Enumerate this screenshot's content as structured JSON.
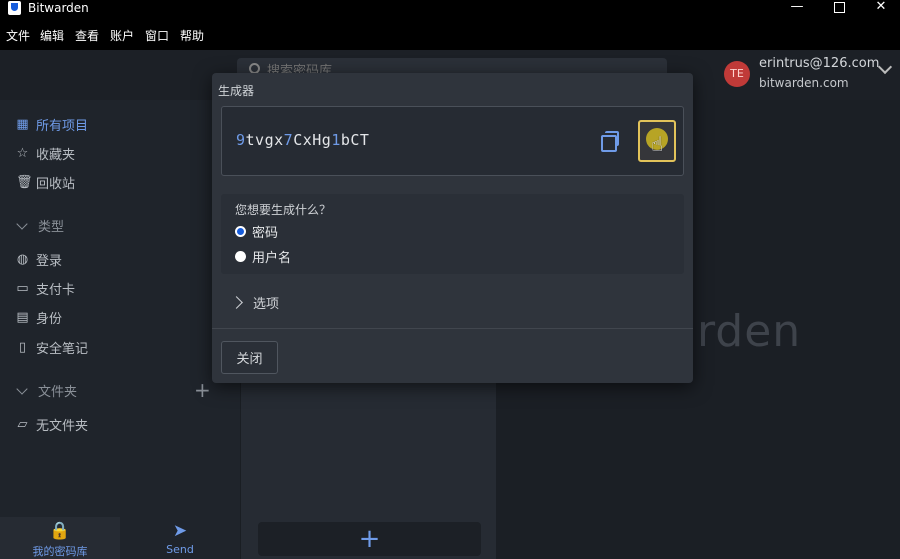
{
  "window": {
    "app_title": "Bitwarden",
    "minimize": "—",
    "close": "✕"
  },
  "menubar": {
    "items": [
      "文件",
      "编辑",
      "查看",
      "账户",
      "窗口",
      "帮助"
    ]
  },
  "header": {
    "search_placeholder": "搜索密码库",
    "account": {
      "avatar_initials": "TE",
      "email": "erintrus@126.com",
      "server": "bitwarden.com"
    }
  },
  "sidebar": {
    "items": [
      {
        "label": "所有项目",
        "icon": "grid-icon",
        "active": true
      },
      {
        "label": "收藏夹",
        "icon": "star-icon"
      },
      {
        "label": "回收站",
        "icon": "trash-icon"
      }
    ],
    "types_header": "类型",
    "types": [
      {
        "label": "登录",
        "icon": "globe-icon"
      },
      {
        "label": "支付卡",
        "icon": "credit-card-icon"
      },
      {
        "label": "身份",
        "icon": "id-card-icon"
      },
      {
        "label": "安全笔记",
        "icon": "note-icon"
      }
    ],
    "folders_header": "文件夹",
    "folders": [
      {
        "label": "无文件夹",
        "icon": "folder-icon"
      }
    ],
    "bottom_tabs": [
      {
        "label": "我的密码库",
        "icon": "lock-icon"
      },
      {
        "label": "Send",
        "icon": "paper-plane-icon"
      }
    ]
  },
  "main": {
    "brand_text": "warden"
  },
  "generator": {
    "title": "生成器",
    "password_prefix_num": "9",
    "password_part1": "tvgx",
    "password_num2": "7",
    "password_part2": "CxHg",
    "password_num3": "1",
    "password_part3": "bCT",
    "question": "您想要生成什么？",
    "options": [
      {
        "label": "密码",
        "checked": true
      },
      {
        "label": "用户名",
        "checked": false
      }
    ],
    "options_toggle": "选项",
    "close_label": "关闭"
  },
  "colors": {
    "accent": "#6f9be8",
    "brand": "#175ddc",
    "avatar": "#c03a38",
    "highlight": "#e2c35a"
  }
}
